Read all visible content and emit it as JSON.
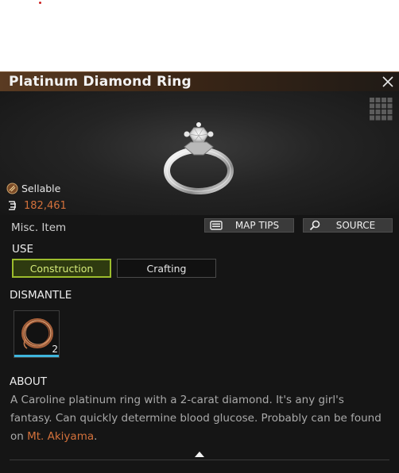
{
  "item": {
    "name": "Platinum Diamond Ring",
    "sellable_label": "Sellable",
    "price": "182,461",
    "category": "Misc. Item"
  },
  "buttons": {
    "map_tips": "MAP TIPS",
    "source": "SOURCE"
  },
  "use": {
    "heading": "USE",
    "tabs": [
      {
        "label": "Construction",
        "selected": true
      },
      {
        "label": "Crafting",
        "selected": false
      }
    ]
  },
  "dismantle": {
    "heading": "DISMANTLE",
    "items": [
      {
        "icon": "copper-wire-icon",
        "quantity": "2"
      }
    ]
  },
  "about": {
    "heading": "ABOUT",
    "text_before": "A Caroline platinum ring with a 2-carat diamond. It's any girl's fantasy. Can quickly determine blood glucose. Probably can be found on ",
    "location_link": "Mt. Akiyama",
    "text_after": "."
  },
  "colors": {
    "accent_orange": "#d3713b",
    "selected_green": "#9cbc2c",
    "bar_blue": "#3fb6dd"
  },
  "icons": [
    "close-icon",
    "grid-icon",
    "ring-image",
    "sellable-icon",
    "currency-icon",
    "map-icon",
    "search-icon",
    "copper-wire-icon",
    "up-arrow-icon"
  ]
}
